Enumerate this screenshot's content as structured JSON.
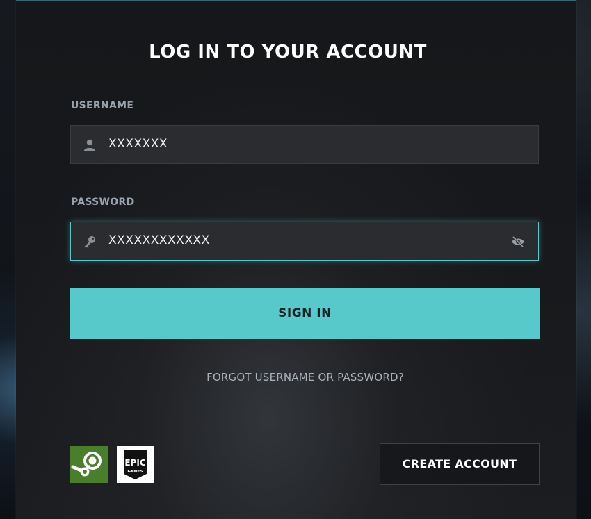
{
  "title": "LOG IN TO YOUR ACCOUNT",
  "username": {
    "label": "USERNAME",
    "value": "XXXXXXX",
    "icon": "user-icon"
  },
  "password": {
    "label": "PASSWORD",
    "value": "XXXXXXXXXXXX",
    "icon": "key-icon",
    "toggle_icon": "eye-slash-icon"
  },
  "buttons": {
    "sign_in": "SIGN IN",
    "create_account": "CREATE ACCOUNT",
    "forgot": "FORGOT USERNAME OR PASSWORD?"
  },
  "platforms": {
    "steam_icon": "steam-icon",
    "epic_icon": "epic-games-icon",
    "epic_top": "EPIC",
    "epic_bottom": "GAMES"
  },
  "colors": {
    "accent": "#58c9ca",
    "focus_border": "#5fc6c8",
    "steam_bg": "#4a7d2c"
  }
}
